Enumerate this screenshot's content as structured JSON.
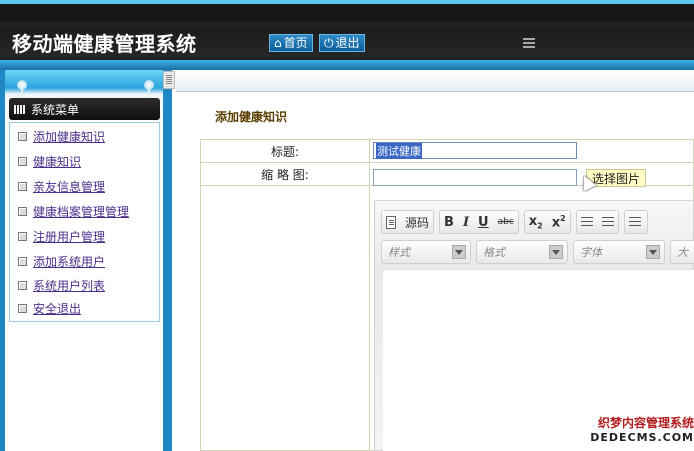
{
  "header": {
    "app_title": "移动端健康管理系统",
    "home_label": "首页",
    "exit_label": "退出"
  },
  "sidebar": {
    "menu_title": "系统菜单",
    "items": [
      {
        "label": "添加健康知识"
      },
      {
        "label": "健康知识"
      },
      {
        "label": "亲友信息管理"
      },
      {
        "label": "健康档案管理管理"
      },
      {
        "label": "注册用户管理"
      },
      {
        "label": "添加系统用户"
      },
      {
        "label": "系统用户列表"
      },
      {
        "label": "安全退出"
      }
    ]
  },
  "main": {
    "section_title": "添加健康知识",
    "form": {
      "title_label": "标题:",
      "title_value": "测试健康",
      "thumb_label": "缩 略 图:",
      "thumb_value": "",
      "choose_image_label": "选择图片"
    },
    "editor": {
      "source_label": "源码",
      "bold": "B",
      "italic": "I",
      "underline": "U",
      "strike": "abc",
      "subscript": "x",
      "superscript": "x",
      "style_placeholder": "样式",
      "format_placeholder": "格式",
      "font_placeholder": "字体",
      "size_placeholder": "大"
    }
  },
  "watermark": {
    "line1": "织梦内容管理系统",
    "line2": "DEDECMS.COM"
  },
  "colors": {
    "accent_blue": "#1f87c6",
    "menu_link": "#4b2e8b",
    "section_title": "#5a3f00"
  }
}
